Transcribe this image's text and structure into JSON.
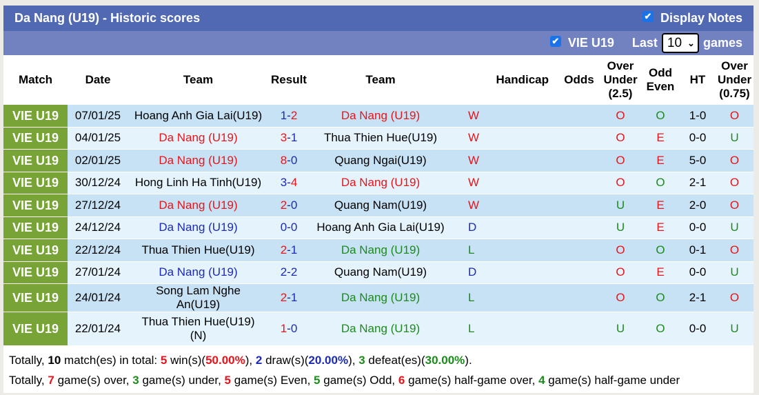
{
  "header": {
    "title": "Da Nang (U19) - Historic scores",
    "display_notes_label": "Display Notes",
    "display_notes_checked": true
  },
  "filter": {
    "league_label": "VIE U19",
    "league_checked": true,
    "last_label": "Last",
    "games_count": "10",
    "games_label": "games"
  },
  "columns": [
    "Match",
    "Date",
    "Team",
    "Result",
    "Team",
    "Handicap",
    "Odds",
    "Over Under (2.5)",
    "Odd Even",
    "HT",
    "Over Under (0.75)"
  ],
  "column_lines": {
    "ou25": [
      "Over",
      "Under",
      "(2.5)"
    ],
    "oddeven": [
      "Odd",
      "Even"
    ],
    "ou075": [
      "Over",
      "Under",
      "(0.75)"
    ]
  },
  "colors": {
    "title_bar": "#5169b3",
    "filter_bar": "#7282c1",
    "league_cell": "#77a337",
    "row_odd": "#c7e2f4",
    "row_even": "#e5f3fc",
    "red": "#e7141b",
    "blue": "#1c2ab8",
    "green": "#1c8a1c"
  },
  "rows": [
    {
      "league": "VIE U19",
      "date": "07/01/25",
      "home": "Hoang Anh Gia Lai(U19)",
      "home_color": "black",
      "score_home": "1",
      "score_away": "2",
      "sh_color": "blue",
      "sa_color": "red",
      "away": "Da Nang (U19)",
      "away_color": "red",
      "wl": "W",
      "wl_color": "red",
      "handicap": "",
      "odds": "",
      "ou": "O",
      "ou_color": "red",
      "oe": "O",
      "oe_color": "green",
      "ht": "1-0",
      "ou2": "O",
      "ou2_color": "red"
    },
    {
      "league": "VIE U19",
      "date": "04/01/25",
      "home": "Da Nang (U19)",
      "home_color": "red",
      "score_home": "3",
      "score_away": "1",
      "sh_color": "red",
      "sa_color": "blue",
      "away": "Thua Thien Hue(U19)",
      "away_color": "black",
      "wl": "W",
      "wl_color": "red",
      "handicap": "",
      "odds": "",
      "ou": "O",
      "ou_color": "red",
      "oe": "E",
      "oe_color": "red",
      "ht": "0-0",
      "ou2": "U",
      "ou2_color": "green"
    },
    {
      "league": "VIE U19",
      "date": "02/01/25",
      "home": "Da Nang (U19)",
      "home_color": "red",
      "score_home": "8",
      "score_away": "0",
      "sh_color": "red",
      "sa_color": "blue",
      "away": "Quang Ngai(U19)",
      "away_color": "black",
      "wl": "W",
      "wl_color": "red",
      "handicap": "",
      "odds": "",
      "ou": "O",
      "ou_color": "red",
      "oe": "E",
      "oe_color": "red",
      "ht": "5-0",
      "ou2": "O",
      "ou2_color": "red"
    },
    {
      "league": "VIE U19",
      "date": "30/12/24",
      "home": "Hong Linh Ha Tinh(U19)",
      "home_color": "black",
      "score_home": "3",
      "score_away": "4",
      "sh_color": "blue",
      "sa_color": "red",
      "away": "Da Nang (U19)",
      "away_color": "red",
      "wl": "W",
      "wl_color": "red",
      "handicap": "",
      "odds": "",
      "ou": "O",
      "ou_color": "red",
      "oe": "O",
      "oe_color": "green",
      "ht": "2-1",
      "ou2": "O",
      "ou2_color": "red"
    },
    {
      "league": "VIE U19",
      "date": "27/12/24",
      "home": "Da Nang (U19)",
      "home_color": "red",
      "score_home": "2",
      "score_away": "0",
      "sh_color": "red",
      "sa_color": "blue",
      "away": "Quang Nam(U19)",
      "away_color": "black",
      "wl": "W",
      "wl_color": "red",
      "handicap": "",
      "odds": "",
      "ou": "U",
      "ou_color": "green",
      "oe": "E",
      "oe_color": "red",
      "ht": "2-0",
      "ou2": "O",
      "ou2_color": "red"
    },
    {
      "league": "VIE U19",
      "date": "24/12/24",
      "home": "Da Nang (U19)",
      "home_color": "blue",
      "score_home": "0",
      "score_away": "0",
      "sh_color": "blue",
      "sa_color": "blue",
      "away": "Hoang Anh Gia Lai(U19)",
      "away_color": "black",
      "wl": "D",
      "wl_color": "blue",
      "handicap": "",
      "odds": "",
      "ou": "U",
      "ou_color": "green",
      "oe": "E",
      "oe_color": "red",
      "ht": "0-0",
      "ou2": "U",
      "ou2_color": "green"
    },
    {
      "league": "VIE U19",
      "date": "22/12/24",
      "home": "Thua Thien Hue(U19)",
      "home_color": "black",
      "score_home": "2",
      "score_away": "1",
      "sh_color": "red",
      "sa_color": "blue",
      "away": "Da Nang (U19)",
      "away_color": "green",
      "wl": "L",
      "wl_color": "green",
      "handicap": "",
      "odds": "",
      "ou": "O",
      "ou_color": "red",
      "oe": "O",
      "oe_color": "green",
      "ht": "0-1",
      "ou2": "O",
      "ou2_color": "red"
    },
    {
      "league": "VIE U19",
      "date": "27/01/24",
      "home": "Da Nang (U19)",
      "home_color": "blue",
      "score_home": "2",
      "score_away": "2",
      "sh_color": "blue",
      "sa_color": "blue",
      "away": "Quang Nam(U19)",
      "away_color": "black",
      "wl": "D",
      "wl_color": "blue",
      "handicap": "",
      "odds": "",
      "ou": "O",
      "ou_color": "red",
      "oe": "E",
      "oe_color": "red",
      "ht": "0-0",
      "ou2": "U",
      "ou2_color": "green"
    },
    {
      "league": "VIE U19",
      "date": "24/01/24",
      "home": "Song Lam Nghe An(U19)",
      "home_color": "black",
      "score_home": "2",
      "score_away": "1",
      "sh_color": "red",
      "sa_color": "blue",
      "away": "Da Nang (U19)",
      "away_color": "green",
      "wl": "L",
      "wl_color": "green",
      "handicap": "",
      "odds": "",
      "ou": "O",
      "ou_color": "red",
      "oe": "O",
      "oe_color": "green",
      "ht": "2-1",
      "ou2": "O",
      "ou2_color": "red"
    },
    {
      "league": "VIE U19",
      "date": "22/01/24",
      "home": "Thua Thien Hue(U19) (N)",
      "home_color": "black",
      "score_home": "1",
      "score_away": "0",
      "sh_color": "red",
      "sa_color": "blue",
      "away": "Da Nang (U19)",
      "away_color": "green",
      "wl": "L",
      "wl_color": "green",
      "handicap": "",
      "odds": "",
      "ou": "U",
      "ou_color": "green",
      "oe": "O",
      "oe_color": "green",
      "ht": "0-0",
      "ou2": "U",
      "ou2_color": "green"
    }
  ],
  "summary": {
    "line1": {
      "prefix": "Totally,",
      "matches": "10",
      "matches_text": "match(es) in total:",
      "wins": "5",
      "wins_text": "win(s)(",
      "wins_pct": "50.00%",
      "draws": "2",
      "draws_text": "draw(s)(",
      "draws_pct": "20.00%",
      "defeats": "3",
      "defeats_text": "defeat(es)(",
      "defeats_pct": "30.00%"
    },
    "line2": {
      "prefix": "Totally,",
      "over": "7",
      "over_text": "game(s) over,",
      "under": "3",
      "under_text": "game(s) under,",
      "even": "5",
      "even_text": "game(s) Even,",
      "odd": "5",
      "odd_text": "game(s) Odd,",
      "hg_over": "6",
      "hg_over_text": "game(s) half-game over,",
      "hg_under": "4",
      "hg_under_text": "game(s) half-game under"
    }
  }
}
